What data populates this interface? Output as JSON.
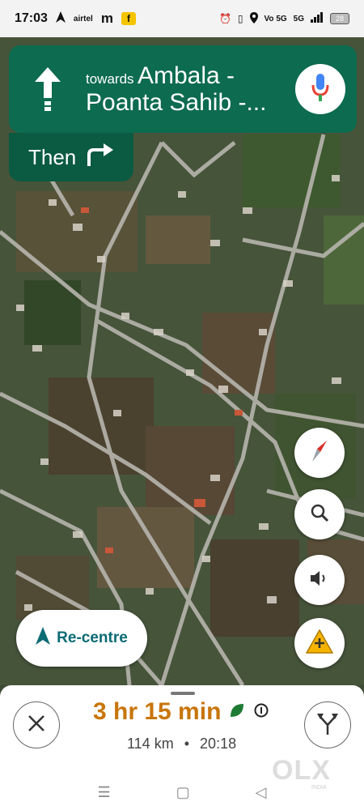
{
  "status_bar": {
    "time": "17:03",
    "left_icons": [
      "navigation-icon",
      "airtel-icon",
      "m-icon",
      "flipkart-icon"
    ],
    "airtel_label": "airtel",
    "m_label": "m",
    "volte_label": "Vo 5G",
    "network_label": "5G",
    "battery": "28"
  },
  "navigation": {
    "towards_label": "towards",
    "destination_line1": "Ambala -",
    "destination_line2": "Poanta Sahib -...",
    "then_label": "Then",
    "maneuver_icon": "arrow-straight-icon",
    "next_maneuver_icon": "turn-right-icon"
  },
  "map_controls": {
    "recentre_label": "Re-centre",
    "icons": [
      "compass-icon",
      "search-icon",
      "volume-icon",
      "add-report-icon"
    ]
  },
  "trip": {
    "eta_duration": "3 hr 15 min",
    "distance": "114 km",
    "separator": "•",
    "arrival_time": "20:18"
  },
  "watermark": {
    "text": "OLX",
    "sub": "INDIA"
  },
  "colors": {
    "banner": "#0d6b4f",
    "then_box": "#0b5a42",
    "eta": "#c8750a",
    "recentre_text": "#0b6b74"
  }
}
